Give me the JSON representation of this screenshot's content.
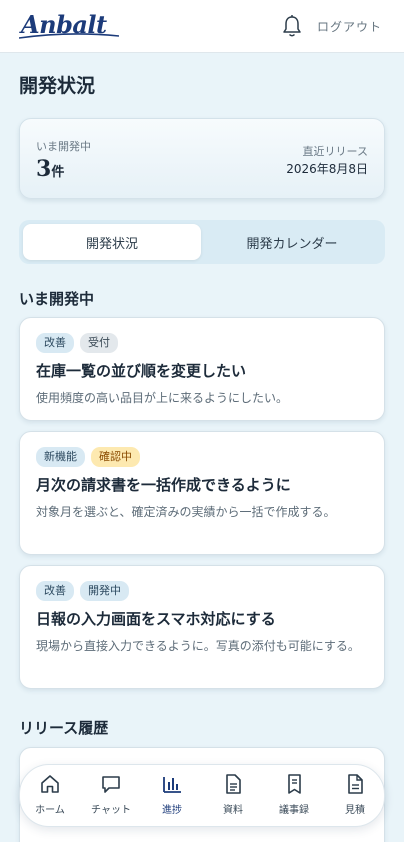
{
  "header": {
    "logo_text": "Anbalt",
    "logout_label": "ログアウト"
  },
  "page_title": "開発状況",
  "summary": {
    "in_dev_label": "いま開発中",
    "count": "3",
    "count_unit": "件",
    "release_label": "直近リリース",
    "release_date": "2026年8月8日"
  },
  "tabs": [
    {
      "label": "開発状況"
    },
    {
      "label": "開発カレンダー"
    }
  ],
  "sections": {
    "in_dev": "いま開発中",
    "release_history": "リリース履歴"
  },
  "cards": [
    {
      "badges": [
        {
          "label": "改善"
        },
        {
          "label": "受付"
        }
      ],
      "title": "在庫一覧の並び順を変更したい",
      "desc": "使用頻度の高い品目が上に来るようにしたい。"
    },
    {
      "badges": [
        {
          "label": "新機能"
        },
        {
          "label": "確認中"
        }
      ],
      "title": "月次の請求書を一括作成できるように",
      "desc": "対象月を選ぶと、確定済みの実績から一括で作成する。"
    },
    {
      "badges": [
        {
          "label": "改善"
        },
        {
          "label": "開発中"
        }
      ],
      "title": "日報の入力画面をスマホ対応にする",
      "desc": "現場から直接入力できるように。写真の添付も可能にする。"
    }
  ],
  "bottom_nav": [
    {
      "label": "ホーム",
      "icon": "home-icon"
    },
    {
      "label": "チャット",
      "icon": "chat-icon"
    },
    {
      "label": "進捗",
      "icon": "bar-chart-icon"
    },
    {
      "label": "資料",
      "icon": "document-icon"
    },
    {
      "label": "議事録",
      "icon": "notebook-icon"
    },
    {
      "label": "見積",
      "icon": "estimate-icon"
    }
  ],
  "colors": {
    "brand": "#1c3b7a",
    "background": "#e9f4f9",
    "badge_blue": "#d8e9f3",
    "badge_yellow": "#fde9b0"
  }
}
